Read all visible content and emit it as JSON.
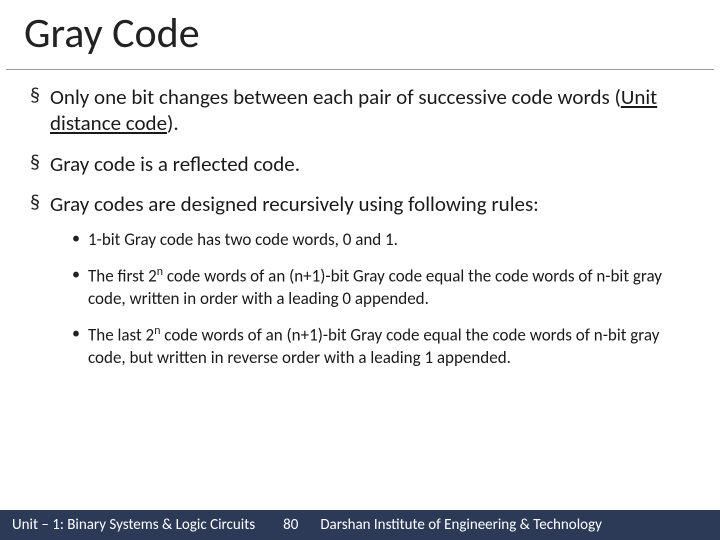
{
  "title": "Gray Code",
  "bullets": [
    {
      "text_a": "Only one bit changes between each pair of successive code words (",
      "text_b": "Unit distance code",
      "text_c": ")."
    },
    {
      "text": "Gray code is a reflected code."
    },
    {
      "text": "Gray codes are designed recursively using following rules:"
    }
  ],
  "sub_bullets": [
    {
      "text": "1-bit Gray code has two code words, 0 and 1."
    },
    {
      "t1": "The first 2",
      "sup": "n",
      "t2": " code words of an (n+1)-bit Gray code equal the code words of n-bit gray code, written in order with a leading 0 appended."
    },
    {
      "t1": "The last 2",
      "sup": "n",
      "t2": " code words of an (n+1)-bit Gray code equal the code words of n-bit gray code, but written in reverse order with a leading 1 appended."
    }
  ],
  "footer": {
    "left": "Unit – 1: Binary Systems & Logic Circuits",
    "page": "80",
    "right": "Darshan Institute of Engineering & Technology"
  }
}
